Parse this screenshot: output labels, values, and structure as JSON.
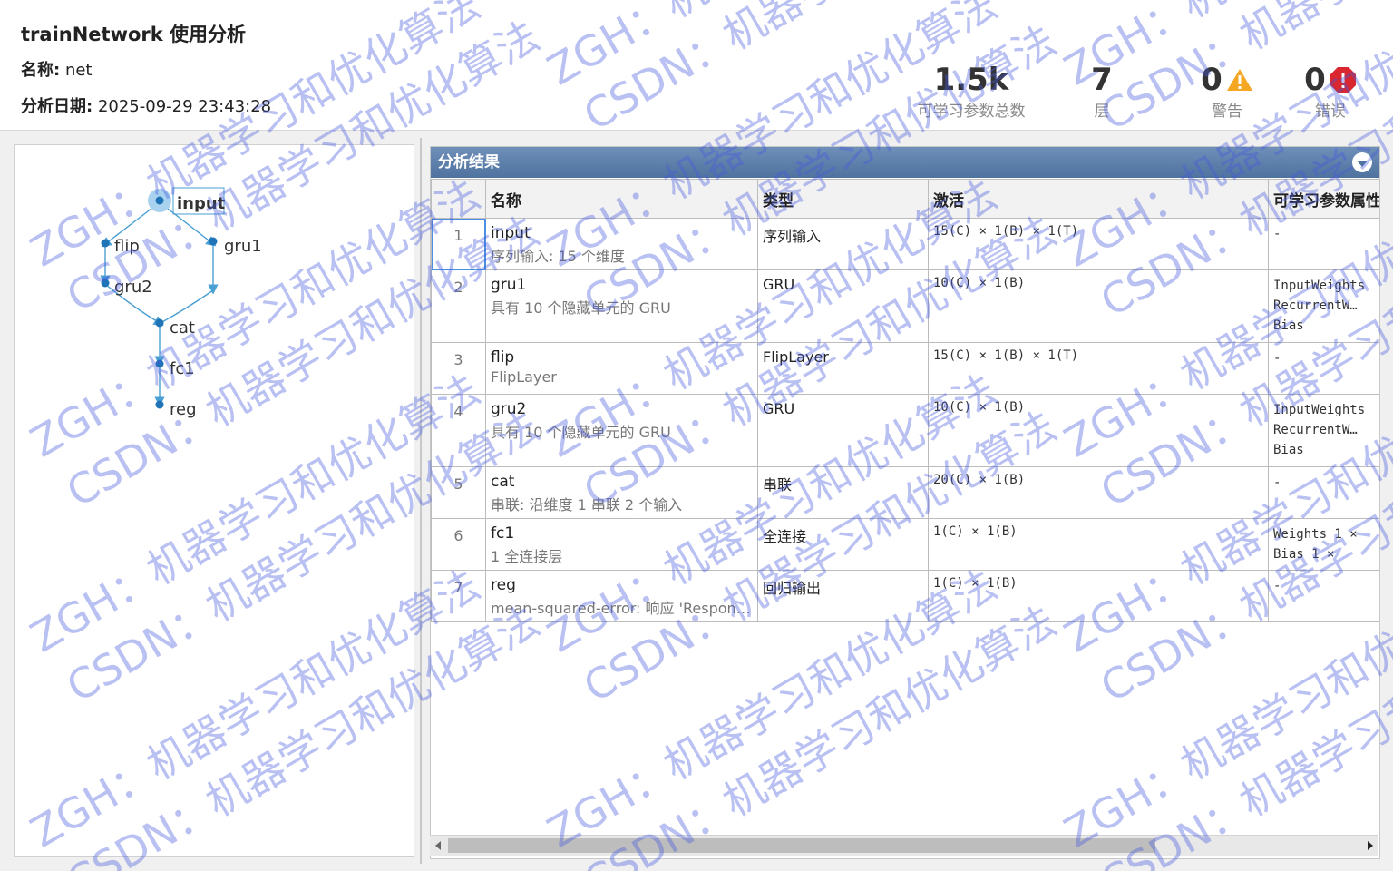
{
  "header": {
    "title": "trainNetwork 使用分析",
    "name_label": "名称:",
    "name_value": "net",
    "date_label": "分析日期:",
    "date_value": "2025-09-29 23:43:28"
  },
  "stats": {
    "learnables": {
      "value": "1.5k",
      "label": "可学习参数总数"
    },
    "layers": {
      "value": "7",
      "label": "层"
    },
    "warnings": {
      "value": "0",
      "label": "警告"
    },
    "errors": {
      "value": "0",
      "label": "错误"
    }
  },
  "graph": {
    "nodes": [
      "input",
      "flip",
      "gru1",
      "gru2",
      "cat",
      "fc1",
      "reg"
    ],
    "selected": "input"
  },
  "results": {
    "title": "分析结果",
    "columns": [
      "",
      "名称",
      "类型",
      "激活",
      "可学习参数属性"
    ],
    "rows": [
      {
        "index": "1",
        "name": "input",
        "desc": "序列输入: 15 个维度",
        "type": "序列输入",
        "activation": "15(C) × 1(B) × 1(T)",
        "learnables": [
          "-"
        ]
      },
      {
        "index": "2",
        "name": "gru1",
        "desc": "具有 10 个隐藏单元的 GRU",
        "type": "GRU",
        "activation": "10(C) × 1(B)",
        "learnables": [
          "InputWeights",
          "RecurrentW…",
          "Bias"
        ]
      },
      {
        "index": "3",
        "name": "flip",
        "desc": "FlipLayer",
        "type": "FlipLayer",
        "activation": "15(C) × 1(B) × 1(T)",
        "learnables": [
          "-"
        ]
      },
      {
        "index": "4",
        "name": "gru2",
        "desc": "具有 10 个隐藏单元的 GRU",
        "type": "GRU",
        "activation": "10(C) × 1(B)",
        "learnables": [
          "InputWeights",
          "RecurrentW…",
          "Bias"
        ]
      },
      {
        "index": "5",
        "name": "cat",
        "desc": "串联: 沿维度 1 串联 2 个输入",
        "type": "串联",
        "activation": "20(C) × 1(B)",
        "learnables": [
          "-"
        ]
      },
      {
        "index": "6",
        "name": "fc1",
        "desc": "1 全连接层",
        "type": "全连接",
        "activation": "1(C) × 1(B)",
        "learnables": [
          "Weights 1 ×",
          "Bias    1 ×"
        ]
      },
      {
        "index": "7",
        "name": "reg",
        "desc": "mean-squared-error: 响应 'Respon…",
        "type": "回归输出",
        "activation": "1(C) × 1(B)",
        "learnables": [
          "-"
        ]
      }
    ]
  },
  "watermark": {
    "line1": "ZGH：机器学习和优化算法",
    "line2": "CSDN：机器学习和优化算法"
  },
  "colors": {
    "accent": "#4f729f",
    "warning": "#f5a623",
    "error": "#d9262f",
    "graph": "#4a9fd4"
  }
}
